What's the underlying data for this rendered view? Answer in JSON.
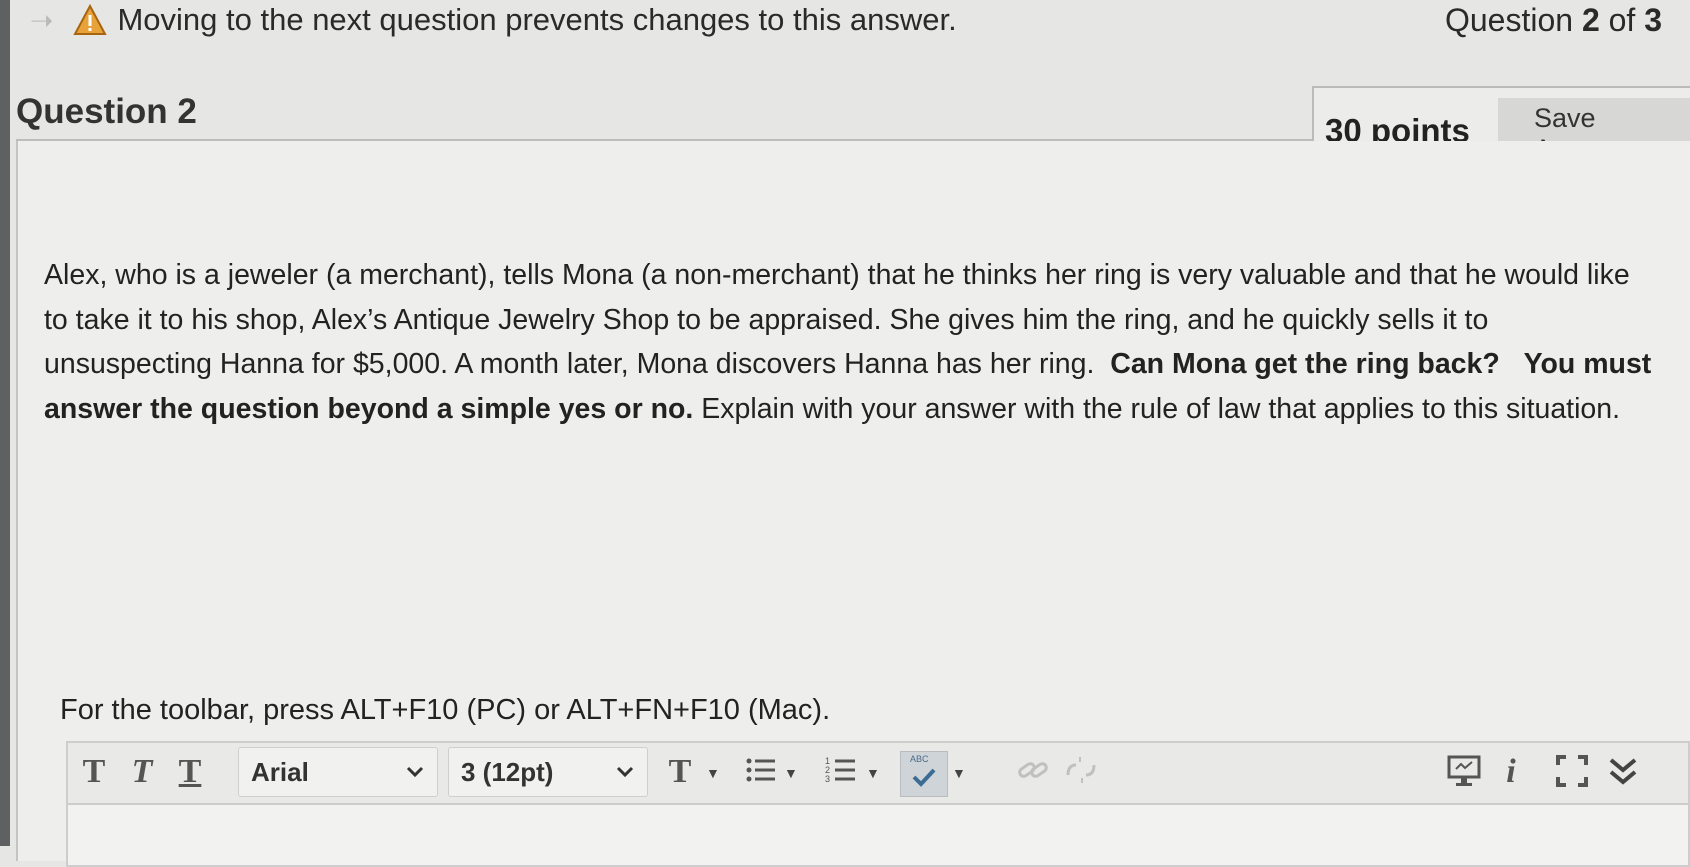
{
  "header": {
    "warning_text": "Moving to the next question prevents changes to this answer.",
    "counter_prefix": "Question ",
    "counter_current": "2",
    "counter_mid": " of ",
    "counter_total": "3"
  },
  "question": {
    "title": "Question 2",
    "points": "30 points",
    "save_label": "Save Answer",
    "text_1": "Alex, who is a jeweler (a merchant), tells Mona (a non-merchant) that he thinks her ring is very valuable and that he would like to take it to his shop, Alex’s Antique Jewelry Shop to be appraised. She gives him the ring, and he quickly sells it to unsuspecting Hanna for $5,000. A month later, Mona discovers Hanna has her ring.",
    "bold_1": "Can Mona get the ring back?",
    "bold_2": "You must answer the question beyond a simple yes or no.",
    "text_2": "Explain with your answer with the rule of law that applies to this situation."
  },
  "editor": {
    "toolbar_hint": "For the toolbar, press ALT+F10 (PC) or ALT+FN+F10 (Mac).",
    "font_family": "Arial",
    "font_size": "3 (12pt)",
    "buttons": [
      "bold-icon",
      "italic-icon",
      "underline-icon",
      "text-color-icon",
      "bullet-list-icon",
      "numbered-list-icon",
      "spellcheck-icon",
      "link-icon",
      "unlink-icon",
      "preview-icon",
      "info-icon",
      "fullscreen-icon",
      "collapse-toolbar-icon"
    ],
    "spellcheck_badge": "ABC"
  },
  "colors": {
    "background": "#e6e6e4",
    "panel": "#eeeeec",
    "warning_icon": "#e8a23a",
    "save_button": "#d7d7d6"
  }
}
